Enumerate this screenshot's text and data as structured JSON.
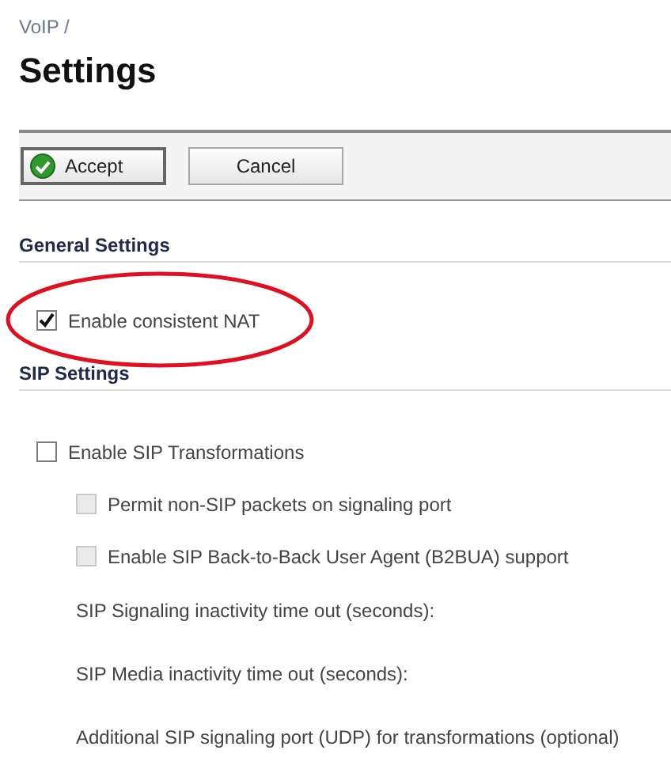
{
  "breadcrumb": "VoIP /",
  "title": "Settings",
  "toolbar": {
    "buttons": [
      {
        "label": "Accept",
        "kind": "primary"
      },
      {
        "label": "Cancel",
        "kind": "plain"
      }
    ]
  },
  "sections": [
    {
      "heading": "General Settings",
      "items": [
        {
          "kind": "checkbox",
          "label": "Enable consistent NAT",
          "checked": true,
          "disabled": false,
          "highlighted": true
        }
      ]
    },
    {
      "heading": "SIP Settings",
      "items": [
        {
          "kind": "checkbox",
          "label": "Enable SIP Transformations",
          "checked": false,
          "disabled": false,
          "highlighted": false,
          "children": [
            {
              "kind": "checkbox",
              "label": "Permit non-SIP packets on signaling port",
              "checked": false,
              "disabled": true,
              "highlighted": false
            },
            {
              "kind": "checkbox",
              "label": "Enable SIP Back-to-Back User Agent (B2BUA) support",
              "checked": false,
              "disabled": true,
              "highlighted": false
            },
            {
              "kind": "label",
              "label": "SIP Signaling inactivity time out (seconds):"
            },
            {
              "kind": "label",
              "label": "SIP Media inactivity time out (seconds):"
            },
            {
              "kind": "label",
              "label": "Additional SIP signaling port (UDP) for transformations (optional)"
            }
          ]
        }
      ]
    }
  ]
}
